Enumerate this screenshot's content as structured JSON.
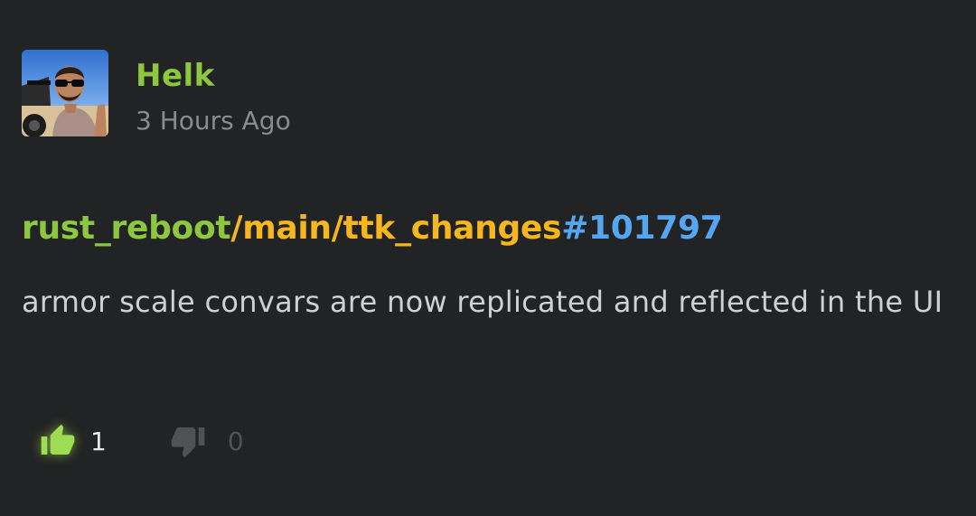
{
  "post": {
    "author": "Helk",
    "timestamp": "3 Hours Ago",
    "avatar_icon": "user-avatar-photo",
    "repo": "rust_reboot",
    "branch": "/main/ttk_changes",
    "changeset": "#101797",
    "message": "armor scale convars are now replicated and reflected in the UI"
  },
  "votes": {
    "up_icon": "thumbs-up-icon",
    "up_count": "1",
    "down_icon": "thumbs-down-icon",
    "down_count": "0"
  },
  "colors": {
    "background": "#222324",
    "author": "#8dc63f",
    "repo": "#8dc63f",
    "branch": "#f5b620",
    "changeset": "#55a6f0",
    "message": "#cfd0d1",
    "timestamp": "#8a8b8c",
    "upvote_active": "#8dc63f",
    "downvote_inactive": "#505152"
  }
}
